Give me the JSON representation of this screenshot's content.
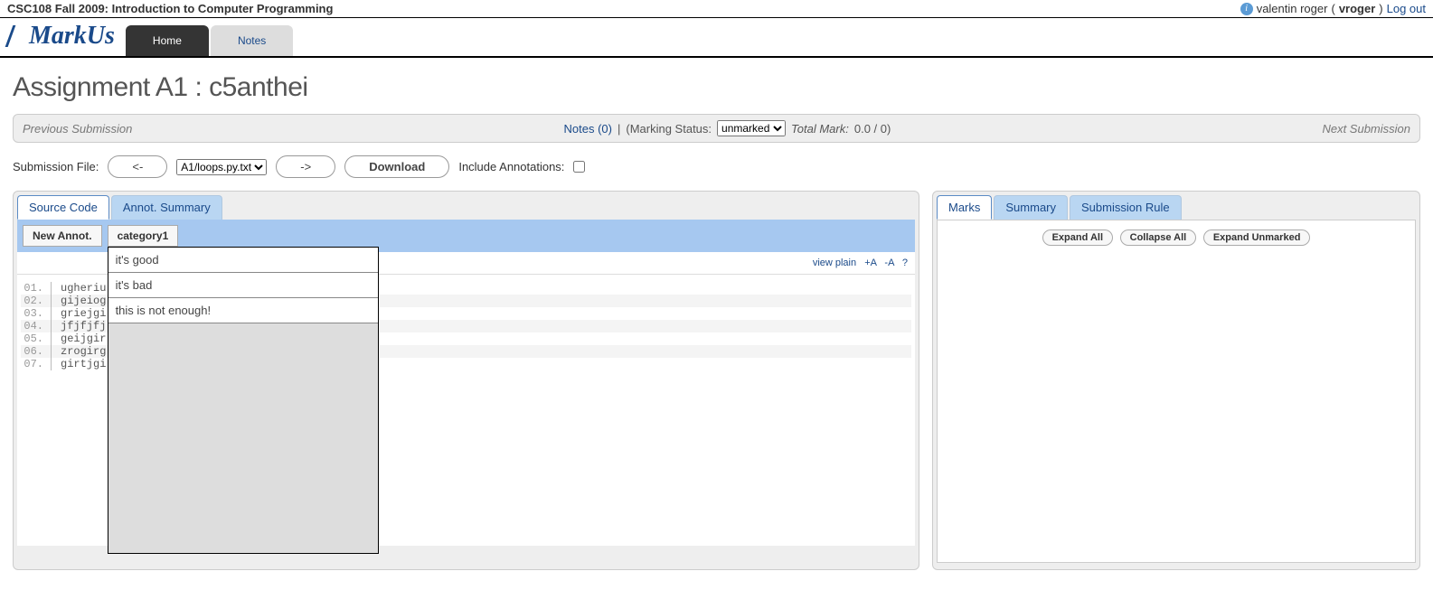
{
  "topbar": {
    "course_title": "CSC108 Fall 2009: Introduction to Computer Programming",
    "user_display": "valentin roger",
    "username": "vroger",
    "logout": "Log out"
  },
  "logo": "arkUs",
  "nav_tabs": [
    {
      "label": "Home",
      "active": true
    },
    {
      "label": "Notes",
      "active": false
    }
  ],
  "page_title": "Assignment A1 : c5anthei",
  "statusbar": {
    "prev": "Previous Submission",
    "notes_link": "Notes (0)",
    "sep": " | ",
    "marking_label": "(Marking Status:",
    "marking_options": [
      "unmarked"
    ],
    "total_label": "Total Mark:",
    "total_value": "0.0 / 0)",
    "next": "Next Submission"
  },
  "filerow": {
    "label": "Submission File:",
    "prev_btn": "<-",
    "file_options": [
      "A1/loops.py.txt"
    ],
    "next_btn": "->",
    "download": "Download",
    "include_label": "Include Annotations:"
  },
  "left_panel": {
    "tabs": [
      {
        "label": "Source Code",
        "active": true
      },
      {
        "label": "Annot. Summary",
        "active": false
      }
    ],
    "new_annot_btn": "New Annot.",
    "category_btn": "category1",
    "dropdown_items": [
      "it's good",
      "it's bad",
      "this is not enough!"
    ],
    "controls": {
      "viewplain": "view plain",
      "plus": "+A",
      "minus": "-A",
      "help": "?"
    },
    "code_lines": [
      {
        "n": "01.",
        "t": "ugheriu"
      },
      {
        "n": "02.",
        "t": "gijeiog"
      },
      {
        "n": "03.",
        "t": "griejgi"
      },
      {
        "n": "04.",
        "t": "jfjfjfj"
      },
      {
        "n": "05.",
        "t": "geijgir"
      },
      {
        "n": "06.",
        "t": "zrogirg"
      },
      {
        "n": "07.",
        "t": "girtjgi"
      }
    ]
  },
  "right_panel": {
    "tabs": [
      {
        "label": "Marks",
        "active": true
      },
      {
        "label": "Summary",
        "active": false
      },
      {
        "label": "Submission Rule",
        "active": false
      }
    ],
    "buttons": {
      "expand": "Expand All",
      "collapse": "Collapse All",
      "unmarked": "Expand Unmarked"
    }
  }
}
